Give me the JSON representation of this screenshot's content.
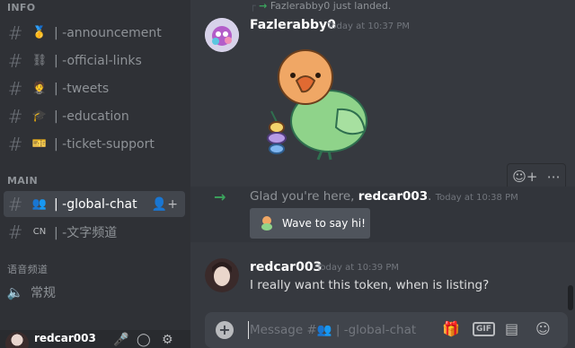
{
  "sidebar": {
    "categories": {
      "info": "INFO",
      "main": "MAIN",
      "voice": "语音频道"
    },
    "channels": [
      {
        "emoji": "🥇",
        "label": "| -announcement"
      },
      {
        "emoji": "⛓",
        "label": "| -official-links"
      },
      {
        "emoji": "🤵",
        "label": "| -tweets"
      },
      {
        "emoji": "🎓",
        "label": "| -education"
      },
      {
        "emoji": "🎫",
        "label": "| -ticket-support"
      }
    ],
    "main_channels": [
      {
        "emoji": "👥",
        "label": "| -global-chat"
      },
      {
        "emoji": "CN",
        "label": "| -文字频道"
      }
    ],
    "voice_channel": {
      "label": "常规"
    }
  },
  "user_panel": {
    "username": "redcar003"
  },
  "chat": {
    "system_top": "Fazlerabby0 just landed.",
    "msg1": {
      "author": "Fazlerabby0",
      "timestamp": "Today at 10:37 PM"
    },
    "join": {
      "prefix": "Glad you're here,",
      "user": "redcar003",
      "suffix": ".",
      "timestamp": "Today at 10:38 PM",
      "wave_label": "Wave to say hi!"
    },
    "msg2": {
      "author": "redcar003",
      "timestamp": "Today at 10:39 PM",
      "text": "I really want this token, when is listing?"
    },
    "composer": {
      "placeholder_prefix": "Message #",
      "placeholder_channel": " | -global-chat"
    }
  },
  "colors": {
    "accent_green": "#3ba55d",
    "bg_chat": "#36393f",
    "bg_sidebar": "#2f3136"
  }
}
